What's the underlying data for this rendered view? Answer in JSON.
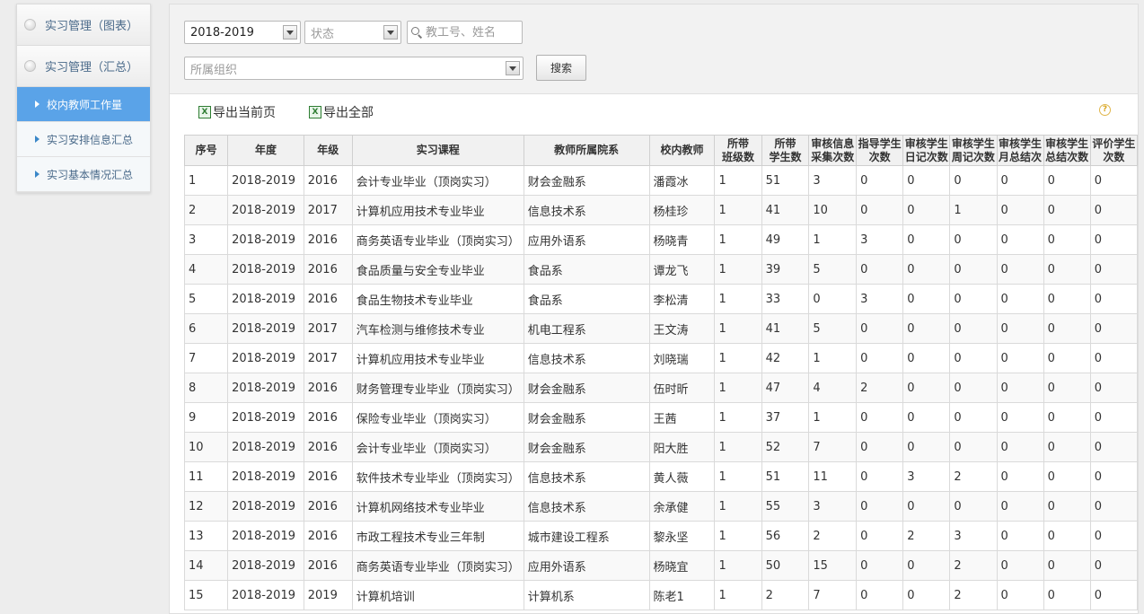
{
  "sidebar": {
    "top_items": [
      "实习管理（图表）",
      "实习管理（汇总）"
    ],
    "sub_items": [
      {
        "label": "校内教师工作量",
        "active": true
      },
      {
        "label": "实习安排信息汇总",
        "active": false
      },
      {
        "label": "实习基本情况汇总",
        "active": false
      }
    ]
  },
  "filters": {
    "year_value": "2018-2019",
    "status_placeholder": "状态",
    "search_placeholder": "教工号、姓名",
    "org_placeholder": "所属组织",
    "search_button": "搜索"
  },
  "toolbar": {
    "export_page": "导出当前页",
    "export_all": "导出全部",
    "xls_icon": "X",
    "help_icon": "?"
  },
  "table": {
    "headers": [
      [
        "序号"
      ],
      [
        "年度"
      ],
      [
        "年级"
      ],
      [
        "实习课程"
      ],
      [
        "教师所属院系"
      ],
      [
        "校内教师"
      ],
      [
        "所带",
        "班级数"
      ],
      [
        "所带",
        "学生数"
      ],
      [
        "审核信息",
        "采集次数"
      ],
      [
        "指导学生",
        "次数"
      ],
      [
        "审核学生",
        "日记次数"
      ],
      [
        "审核学生",
        "周记次数"
      ],
      [
        "审核学生",
        "月总结次"
      ],
      [
        "审核学生",
        "总结次数"
      ],
      [
        "评价学生",
        "次数"
      ]
    ],
    "rows": [
      [
        "1",
        "2018-2019",
        "2016",
        "会计专业毕业（顶岗实习）",
        "财会金融系",
        "潘霞冰",
        "1",
        "51",
        "3",
        "0",
        "0",
        "0",
        "0",
        "0",
        "0"
      ],
      [
        "2",
        "2018-2019",
        "2017",
        "计算机应用技术专业毕业",
        "信息技术系",
        "杨桂珍",
        "1",
        "41",
        "10",
        "0",
        "0",
        "1",
        "0",
        "0",
        "0"
      ],
      [
        "3",
        "2018-2019",
        "2016",
        "商务英语专业毕业（顶岗实习）",
        "应用外语系",
        "杨晓青",
        "1",
        "49",
        "1",
        "3",
        "0",
        "0",
        "0",
        "0",
        "0"
      ],
      [
        "4",
        "2018-2019",
        "2016",
        "食品质量与安全专业毕业",
        "食品系",
        "谭龙飞",
        "1",
        "39",
        "5",
        "0",
        "0",
        "0",
        "0",
        "0",
        "0"
      ],
      [
        "5",
        "2018-2019",
        "2016",
        "食品生物技术专业毕业",
        "食品系",
        "李松清",
        "1",
        "33",
        "0",
        "3",
        "0",
        "0",
        "0",
        "0",
        "0"
      ],
      [
        "6",
        "2018-2019",
        "2017",
        "汽车检测与维修技术专业",
        "机电工程系",
        "王文涛",
        "1",
        "41",
        "5",
        "0",
        "0",
        "0",
        "0",
        "0",
        "0"
      ],
      [
        "7",
        "2018-2019",
        "2017",
        "计算机应用技术专业毕业",
        "信息技术系",
        "刘晓瑞",
        "1",
        "42",
        "1",
        "0",
        "0",
        "0",
        "0",
        "0",
        "0"
      ],
      [
        "8",
        "2018-2019",
        "2016",
        "财务管理专业毕业（顶岗实习）",
        "财会金融系",
        "伍时昕",
        "1",
        "47",
        "4",
        "2",
        "0",
        "0",
        "0",
        "0",
        "0"
      ],
      [
        "9",
        "2018-2019",
        "2016",
        "保险专业毕业（顶岗实习）",
        "财会金融系",
        "王茜",
        "1",
        "37",
        "1",
        "0",
        "0",
        "0",
        "0",
        "0",
        "0"
      ],
      [
        "10",
        "2018-2019",
        "2016",
        "会计专业毕业（顶岗实习）",
        "财会金融系",
        "阳大胜",
        "1",
        "52",
        "7",
        "0",
        "0",
        "0",
        "0",
        "0",
        "0"
      ],
      [
        "11",
        "2018-2019",
        "2016",
        "软件技术专业毕业（顶岗实习）",
        "信息技术系",
        "黄人薇",
        "1",
        "51",
        "11",
        "0",
        "3",
        "2",
        "0",
        "0",
        "0"
      ],
      [
        "12",
        "2018-2019",
        "2016",
        "计算机网络技术专业毕业",
        "信息技术系",
        "余承健",
        "1",
        "55",
        "3",
        "0",
        "0",
        "0",
        "0",
        "0",
        "0"
      ],
      [
        "13",
        "2018-2019",
        "2016",
        "市政工程技术专业三年制",
        "城市建设工程系",
        "黎永坚",
        "1",
        "56",
        "2",
        "0",
        "2",
        "3",
        "0",
        "0",
        "0"
      ],
      [
        "14",
        "2018-2019",
        "2016",
        "商务英语专业毕业（顶岗实习）",
        "应用外语系",
        "杨晓宜",
        "1",
        "50",
        "15",
        "0",
        "0",
        "2",
        "0",
        "0",
        "0"
      ],
      [
        "15",
        "2018-2019",
        "2019",
        "计算机培训",
        "计算机系",
        "陈老1",
        "1",
        "2",
        "7",
        "0",
        "0",
        "2",
        "0",
        "0",
        "0"
      ]
    ]
  }
}
